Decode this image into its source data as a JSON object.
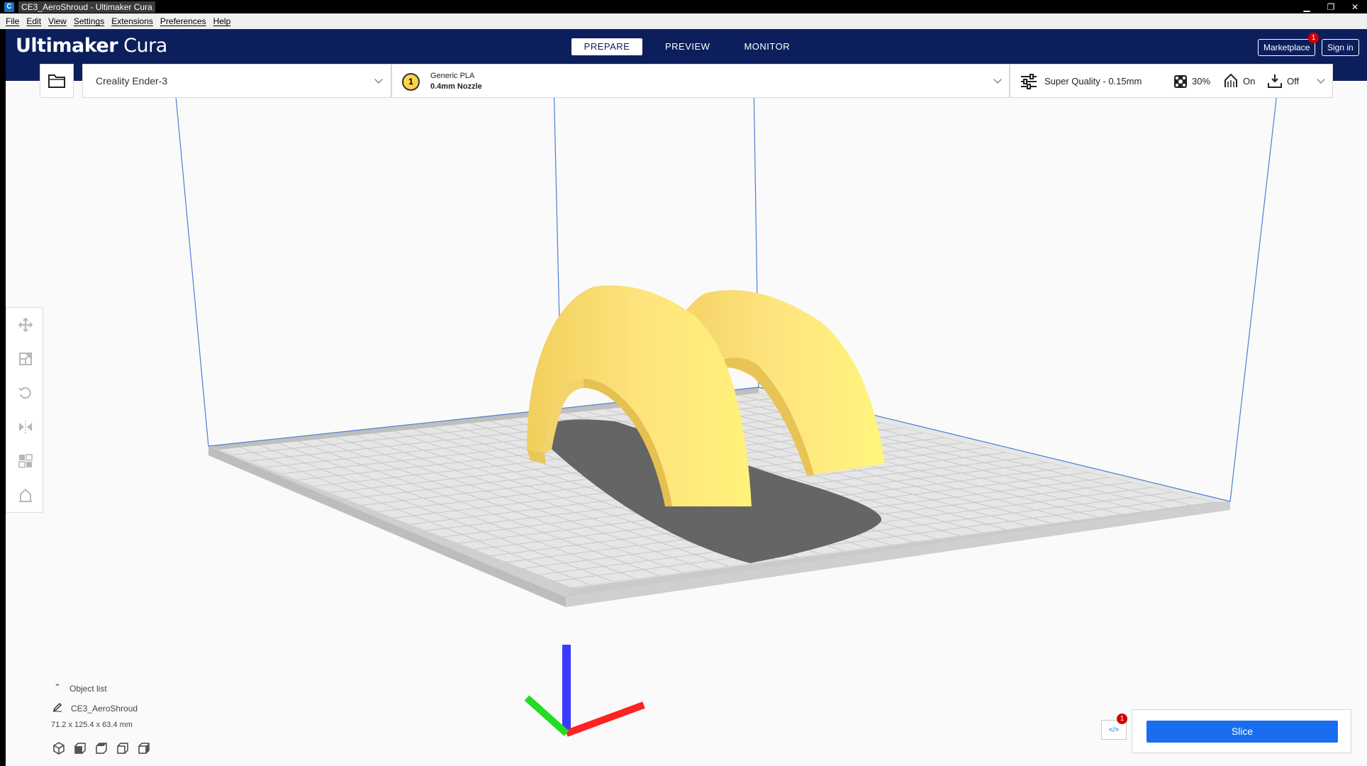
{
  "window": {
    "title": "CE3_AeroShroud - Ultimaker Cura",
    "app_icon": "C"
  },
  "menu": [
    "File",
    "Edit",
    "View",
    "Settings",
    "Extensions",
    "Preferences",
    "Help"
  ],
  "header": {
    "logo_bold": "Ultimaker",
    "logo_light": " Cura",
    "tabs": [
      "PREPARE",
      "PREVIEW",
      "MONITOR"
    ],
    "marketplace_label": "Marketplace",
    "marketplace_badge": "1",
    "signin_label": "Sign in"
  },
  "printer": {
    "name": "Creality Ender-3"
  },
  "extruder": {
    "number": "1",
    "material": "Generic PLA",
    "nozzle": "0.4mm Nozzle"
  },
  "print_settings": {
    "profile": "Super Quality - 0.15mm",
    "infill": "30%",
    "support": "On",
    "adhesion": "Off"
  },
  "object_list": {
    "title": "Object list",
    "object_name": "CE3_AeroShroud",
    "dimensions": "71.2 x 125.4 x 63.4 mm"
  },
  "slice": {
    "label": "Slice",
    "notification_badge": "1"
  },
  "colors": {
    "header": "#0c1f5c",
    "accent": "#196ef0",
    "model": "#ffe274",
    "badge": "#d40000"
  },
  "icons": {
    "open": "folder-icon",
    "tools": [
      "move-icon",
      "scale-icon",
      "rotate-icon",
      "mirror-icon",
      "per-model-settings-icon",
      "support-blocker-icon"
    ],
    "views": [
      "3d-view-icon",
      "front-view-icon",
      "top-view-icon",
      "left-view-icon",
      "right-view-icon"
    ]
  }
}
